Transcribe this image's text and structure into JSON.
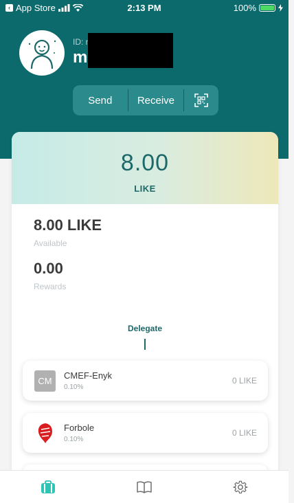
{
  "status_bar": {
    "back_app": "App Store",
    "time": "2:13 PM",
    "battery": "100%"
  },
  "profile": {
    "id_label": "ID: mi",
    "name": "m"
  },
  "actions": {
    "send": "Send",
    "receive": "Receive",
    "scan_icon": "qr-scan-icon"
  },
  "balance": {
    "amount": "8.00",
    "unit": "LIKE",
    "available_value": "8.00 LIKE",
    "available_label": "Available",
    "rewards_value": "0.00",
    "rewards_label": "Rewards"
  },
  "tabs": {
    "delegate": "Delegate"
  },
  "validators": [
    {
      "logo_text": "CM",
      "name": "CMEF-Enyk",
      "rate": "0.10%",
      "amount": "0 LIKE"
    },
    {
      "logo_text": "",
      "name": "Forbole",
      "rate": "0.10%",
      "amount": "0 LIKE"
    }
  ],
  "tab_bar": {
    "items": [
      "wallet-icon",
      "book-icon",
      "settings-gear-icon"
    ],
    "active": 0
  },
  "colors": {
    "brand": "#0c6a6c",
    "accent": "#2ec4b6",
    "text_dark": "#3a3a3a",
    "text_muted": "#9aa3a6"
  }
}
